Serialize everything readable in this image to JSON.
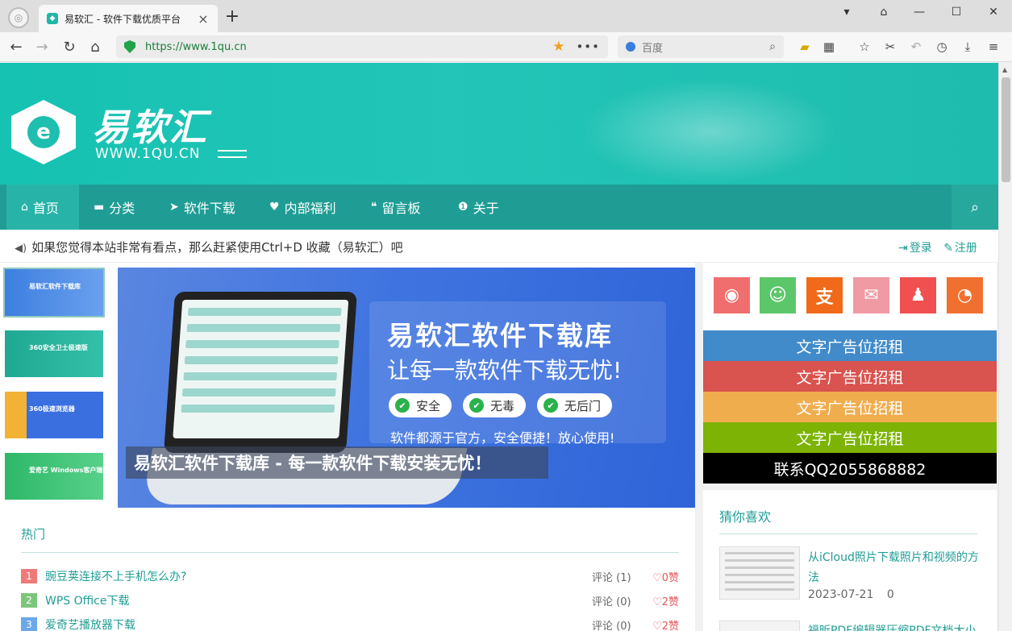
{
  "browser": {
    "tab_title": "易软汇 - 软件下载优质平台",
    "new_tab": "+",
    "url": "https://www.1qu.cn",
    "search_placeholder": "百度"
  },
  "site": {
    "logo_text": "易软汇",
    "logo_sub": "WWW.1QU.CN",
    "nav": [
      {
        "label": "首页",
        "icon": "home-icon"
      },
      {
        "label": "分类",
        "icon": "folder-icon"
      },
      {
        "label": "软件下载",
        "icon": "send-icon"
      },
      {
        "label": "内部福利",
        "icon": "heart-icon"
      },
      {
        "label": "留言板",
        "icon": "comments-icon"
      },
      {
        "label": "关于",
        "icon": "info-icon"
      }
    ],
    "notice": "如果您觉得本站非常有看点，那么赶紧使用Ctrl+D 收藏（易软汇）吧",
    "login": "登录",
    "register": "注册"
  },
  "thumbs": [
    {
      "label": "易软汇软件下载库",
      "color": "#dff2ee"
    },
    {
      "label": "360安全卫士极速版",
      "color": "#27b0a0"
    },
    {
      "label": "360极速浏览器",
      "color": "#3a6fe0"
    },
    {
      "label": "爱奇艺 Windows客户端",
      "color": "#2db868"
    }
  ],
  "banner": {
    "title": "易软汇软件下载库",
    "subtitle": "让每一款软件下载无忧!",
    "pills": [
      "安全",
      "无毒",
      "无后门"
    ],
    "foot": "软件都源于官方，安全便捷！放心使用!",
    "caption": "易软汇软件下载库 - 每一款软件下载安装无忧！"
  },
  "hot": {
    "title": "热门",
    "items": [
      {
        "rank": "1",
        "name": "豌豆荚连接不上手机怎么办?",
        "comments": "评论 (1)",
        "likes": "0赞",
        "color": "#f07a7a"
      },
      {
        "rank": "2",
        "name": "WPS Office下载",
        "comments": "评论 (0)",
        "likes": "2赞",
        "color": "#7cc67c"
      },
      {
        "rank": "3",
        "name": "爱奇艺播放器下载",
        "comments": "评论 (0)",
        "likes": "2赞",
        "color": "#6aa8e8"
      }
    ]
  },
  "social": [
    {
      "name": "weibo-icon",
      "color": "#f06e6e",
      "glyph": "◉"
    },
    {
      "name": "wechat-icon",
      "color": "#5cc66a",
      "glyph": "☺"
    },
    {
      "name": "alipay-icon",
      "color": "#f06a1a",
      "glyph": "支"
    },
    {
      "name": "mail-icon",
      "color": "#f09aa4",
      "glyph": "✉"
    },
    {
      "name": "qq-icon",
      "color": "#f05050",
      "glyph": "♟"
    },
    {
      "name": "rss-icon",
      "color": "#f07030",
      "glyph": "◔"
    }
  ],
  "ads": [
    {
      "label": "文字广告位招租",
      "color": "#428bca"
    },
    {
      "label": "文字广告位招租",
      "color": "#d9534f"
    },
    {
      "label": "文字广告位招租",
      "color": "#f0ad4e"
    },
    {
      "label": "文字广告位招租",
      "color": "#7cb305"
    },
    {
      "label": "联系QQ2055868882",
      "color": "#000000"
    }
  ],
  "guess": {
    "title": "猜你喜欢",
    "item1_title": "从iCloud照片下载照片和视频的方法",
    "item1_date": "2023-07-21",
    "item1_count": "0",
    "item2_title": "福昕PDF编辑器压缩PDF文档大小"
  }
}
